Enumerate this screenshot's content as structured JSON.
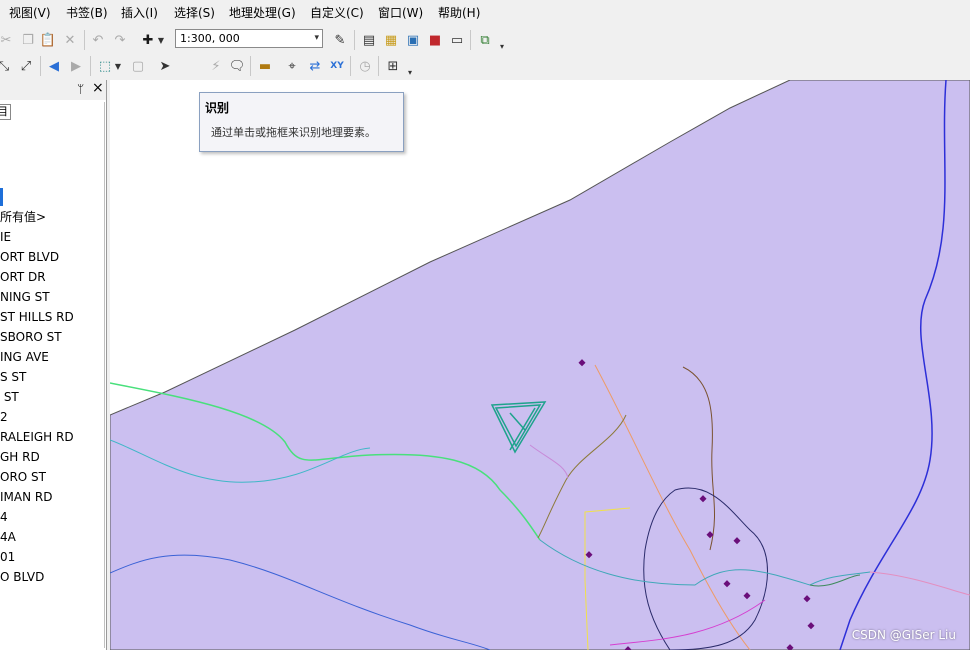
{
  "menubar": {
    "items": [
      {
        "label": "视图(V)"
      },
      {
        "label": "书签(B)"
      },
      {
        "label": "插入(I)"
      },
      {
        "label": "选择(S)"
      },
      {
        "label": "地理处理(G)"
      },
      {
        "label": "自定义(C)"
      },
      {
        "label": "窗口(W)"
      },
      {
        "label": "帮助(H)"
      }
    ]
  },
  "toolbar": {
    "scale_value": "1:300, 000"
  },
  "tooltip": {
    "title": "识别",
    "description": "通过单击或拖框来识别地理要素。"
  },
  "panel": {
    "pin_symbol": "ᛘ",
    "close_symbol": "×",
    "tab_label": "目",
    "items": [
      "所有值>",
      "IE",
      "ORT BLVD",
      "ORT DR",
      "NING ST",
      "ST HILLS RD",
      "SBORO ST",
      "ING AVE",
      "S ST",
      " ST",
      "2",
      "RALEIGH RD",
      "GH RD",
      "ORO ST",
      "IMAN RD",
      "4",
      "4A",
      "01",
      "O BLVD"
    ]
  },
  "map": {
    "fill_color": "#cbbff0",
    "outline_color": "#555555",
    "point_color": "#6a0e7a"
  },
  "watermark": "CSDN @GISer Liu"
}
